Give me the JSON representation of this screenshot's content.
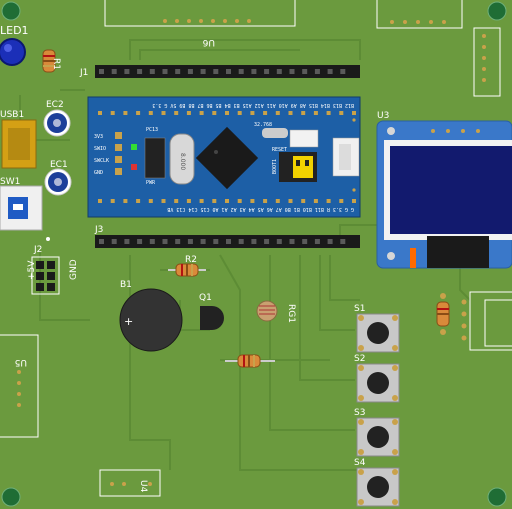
{
  "board": {
    "colors": {
      "pcb": "#6b9a3e",
      "trace": "#5a8a33",
      "silkscreen": "#ffffff",
      "mcu_board": "#1d5fa6",
      "oled_frame": "#3a78c9",
      "oled_screen": "#121a6e",
      "header_pin": "#1a1a1a",
      "pad": "#c9a24a"
    },
    "labels": {
      "led1": "LED1",
      "r1": "R1",
      "j1": "J1",
      "u6": "U6",
      "usb1": "USB1",
      "ec2": "EC2",
      "ec1": "EC1",
      "sw1": "SW1",
      "j2": "J2",
      "plus5v": "+5V",
      "gnd": "GND",
      "j3": "J3",
      "u3": "U3",
      "r2": "R2",
      "b1": "B1",
      "q1": "Q1",
      "rg1": "RG1",
      "s1": "S1",
      "s2": "S2",
      "s3": "S3",
      "s4": "S4",
      "u5": "U5",
      "u4": "U4"
    },
    "mcu": {
      "top_pins": "B12 B13 B14 B15 A8 A9 A10 A11 A12 A15 B3 B4 B5 B6 B7 B8 B9 5V G 3.3",
      "bottom_pins": "G G 3.3 R B11 B10 B1 B0 A7 A6 A5 A4 A3 A2 A1 A0 C15 C14 C13 VB",
      "side_pins": [
        "3.3",
        "IO",
        "CLK",
        "GND"
      ],
      "swd_labels": [
        "3V3",
        "SWIO",
        "SWCLK",
        "GND"
      ],
      "pc13": "PC13",
      "pwr": "PWR",
      "crystal": "8.000",
      "crystal_32": "32.768",
      "boot": "BOOT1",
      "reset": "RESET"
    }
  }
}
